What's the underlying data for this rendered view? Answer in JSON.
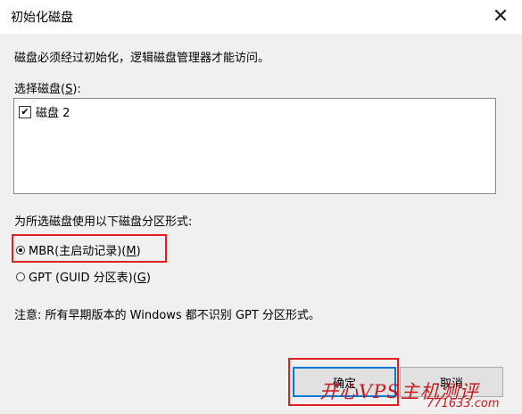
{
  "window": {
    "title": "初始化磁盘",
    "close_glyph": "✕"
  },
  "description": "磁盘必须经过初始化，逻辑磁盘管理器才能访问。",
  "disk_list": {
    "label_prefix": "选择磁盘(",
    "label_key": "S",
    "label_suffix": "):",
    "items": [
      {
        "label": "磁盘 2",
        "checked": true,
        "check_glyph": "✔"
      }
    ]
  },
  "partition_style": {
    "label": "为所选磁盘使用以下磁盘分区形式:",
    "options": [
      {
        "text": "MBR(主启动记录)(",
        "key": "M",
        "suffix": ")",
        "selected": true
      },
      {
        "text": "GPT (GUID 分区表)(",
        "key": "G",
        "suffix": ")",
        "selected": false
      }
    ]
  },
  "note": "注意: 所有早期版本的 Windows 都不识别 GPT 分区形式。",
  "buttons": {
    "ok": "确定",
    "cancel": "取消"
  },
  "watermark": {
    "text": "开心VPS主机测评",
    "sub": "771633.com"
  },
  "colors": {
    "highlight": "#e0201f",
    "accent": "#0078d7",
    "watermark": "#c8191e"
  }
}
